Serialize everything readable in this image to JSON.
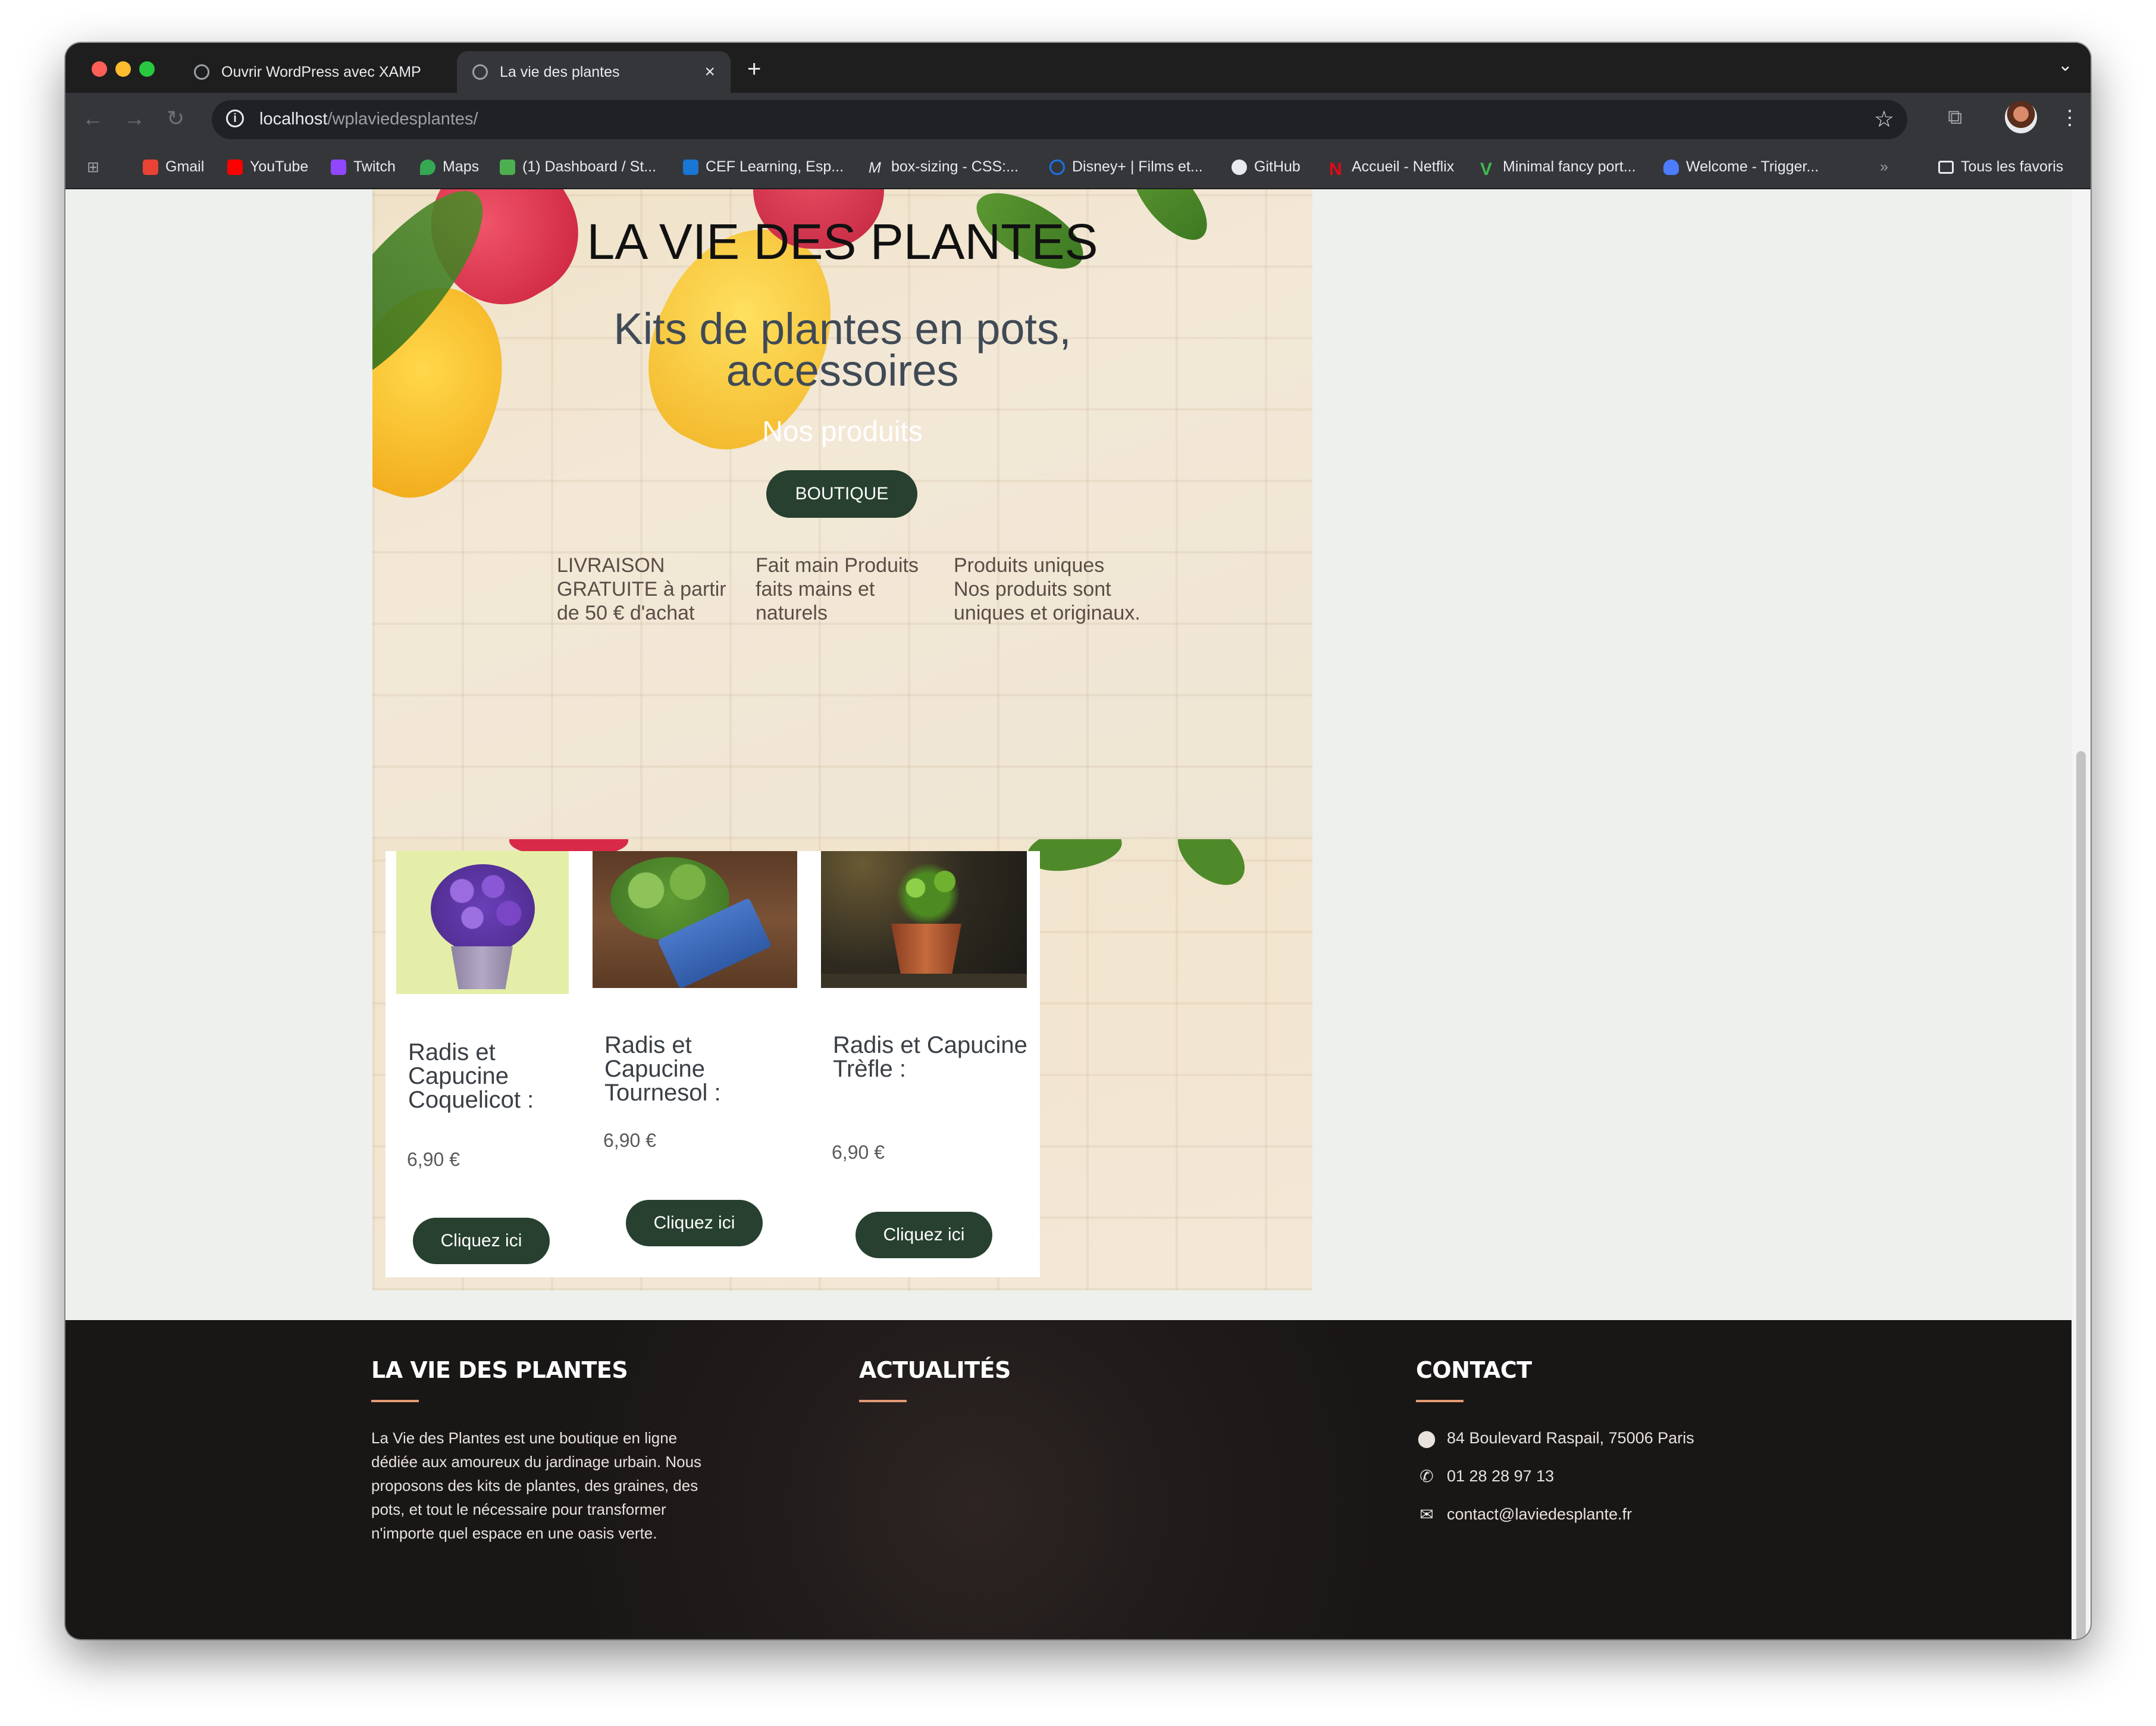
{
  "browser": {
    "tabs": [
      {
        "title": "Ouvrir WordPress avec XAMP",
        "active": false
      },
      {
        "title": "La vie des plantes",
        "active": true
      }
    ],
    "new_tab_label": "+",
    "url_host": "localhost",
    "url_path": "/wplaviedesplantes/",
    "bookmarks": [
      {
        "label": "Gmail",
        "color": "#ea4335"
      },
      {
        "label": "YouTube",
        "color": "#ff0000"
      },
      {
        "label": "Twitch",
        "color": "#9146ff"
      },
      {
        "label": "Maps",
        "color": "#34a853"
      },
      {
        "label": "(1) Dashboard / St...",
        "color": "#4caf50"
      },
      {
        "label": "CEF Learning, Esp...",
        "color": "#1976d2"
      },
      {
        "label": "box-sizing - CSS:...",
        "color": "#9aa0a6"
      },
      {
        "label": "Disney+ | Films et...",
        "color": "#1a73e8"
      },
      {
        "label": "GitHub",
        "color": "#e8eaed"
      },
      {
        "label": "Accueil - Netflix",
        "color": "#e50914"
      },
      {
        "label": "Minimal fancy port...",
        "color": "#3fb950"
      },
      {
        "label": "Welcome - Trigger...",
        "color": "#4d7cff"
      }
    ],
    "bookmarks_overflow": "»",
    "all_bookmarks": "Tous les favoris"
  },
  "hero": {
    "title": "LA VIE DES PLANTES",
    "subtitle": "Kits de plantes en pots, accessoires",
    "products_heading": "Nos produits",
    "cta": "BOUTIQUE",
    "features": [
      "LIVRAISON GRATUITE à partir de 50 € d'achat",
      "Fait main Produits faits mains et naturels",
      "Produits uniques Nos produits sont uniques et originaux."
    ]
  },
  "products": [
    {
      "name": "Radis et Capucine Coquelicot :",
      "price": "6,90 €",
      "button": "Cliquez ici"
    },
    {
      "name": "Radis et Capucine Tournesol :",
      "price": "6,90 €",
      "button": "Cliquez ici"
    },
    {
      "name": "Radis et Capucine Trèfle :",
      "price": "6,90 €",
      "button": "Cliquez ici"
    }
  ],
  "footer": {
    "about_title": "LA VIE DES PLANTES",
    "about_text": "La Vie des Plantes est une boutique en ligne dédiée aux amoureux du jardinage urbain. Nous proposons des kits de plantes, des graines, des pots, et tout le nécessaire pour transformer n'importe quel espace en une oasis verte.",
    "news_title": "ACTUALITÉS",
    "contact_title": "CONTACT",
    "address": "84 Boulevard Raspail, 75006 Paris",
    "phone": "01 28 28 97 13",
    "email": "contact@laviedesplante.fr"
  },
  "colors": {
    "accent_green": "#27402f",
    "footer_accent": "#e29a74"
  }
}
